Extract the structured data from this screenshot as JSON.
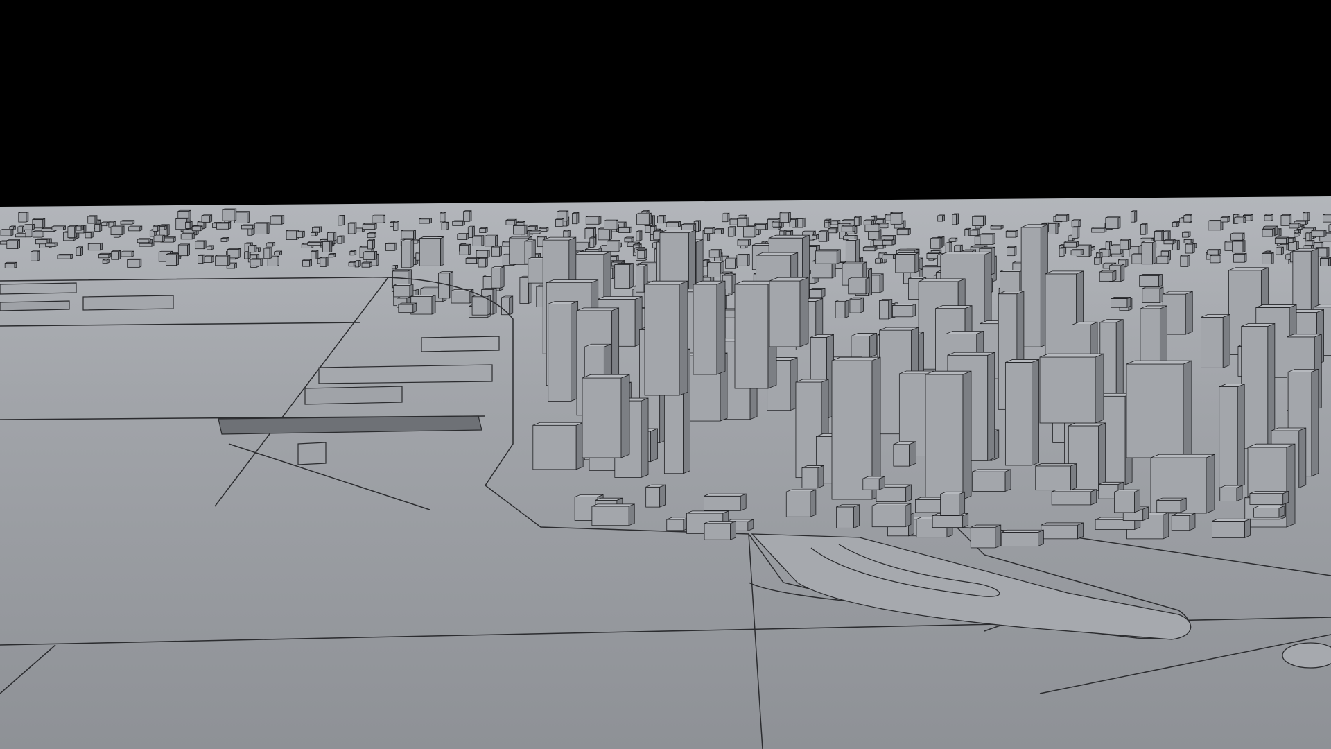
{
  "scene": {
    "subject": "city-model-render",
    "colors": {
      "sky": "#000000",
      "ground": "#9a9da2",
      "ground_far": "#b2b5ba",
      "water_line": "#2a2b2e",
      "building_light": "#b6b9be",
      "building_mid": "#a3a6ab",
      "building_dark": "#7c7f84",
      "outline": "#202124"
    }
  }
}
